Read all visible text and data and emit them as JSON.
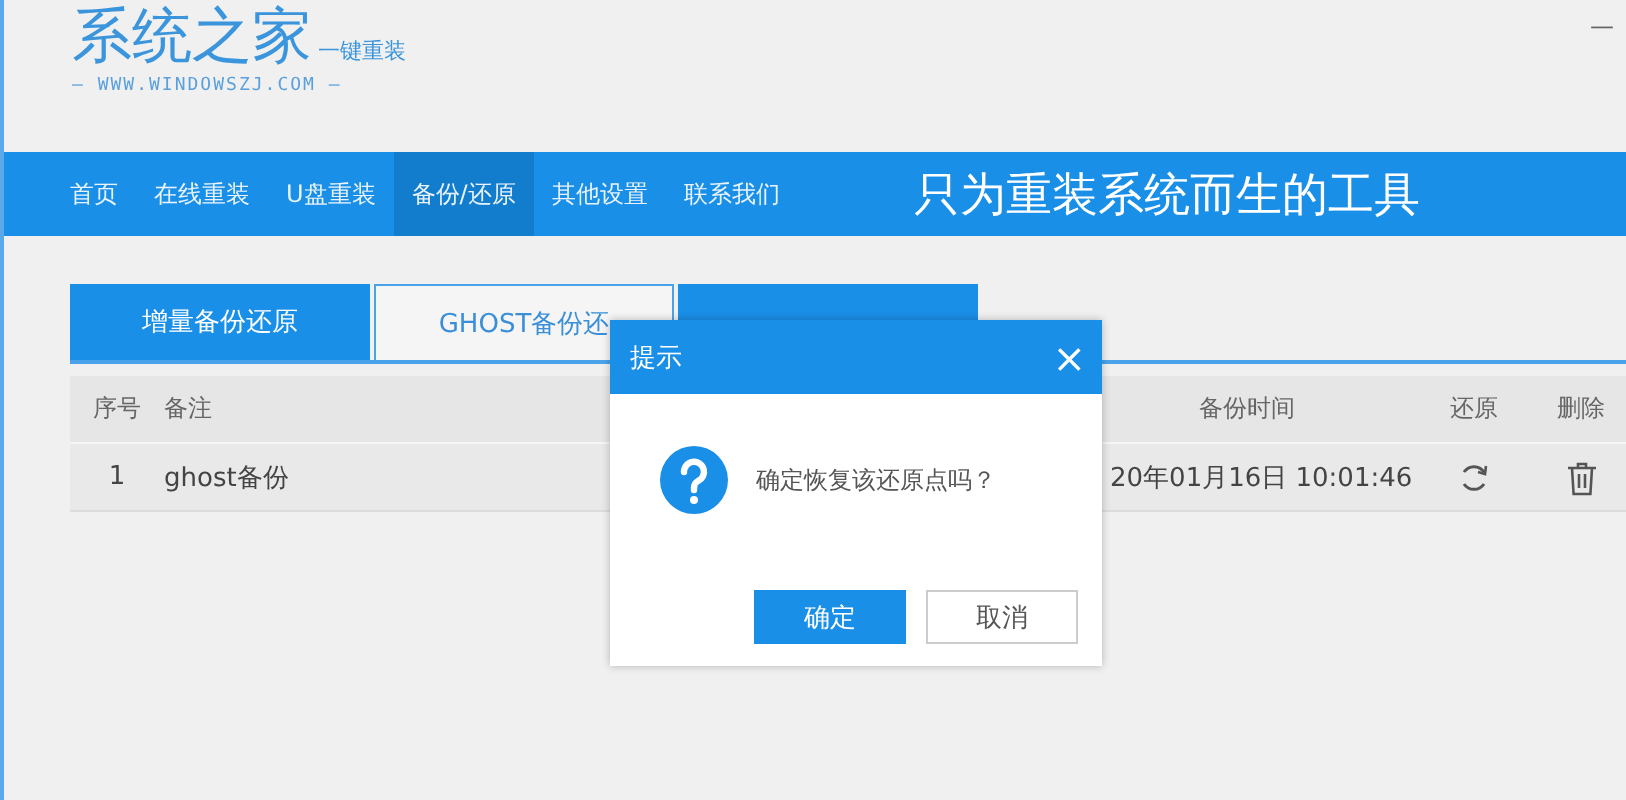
{
  "logo": {
    "title": "系统之家",
    "tagline": "一键重装",
    "url": "— WWW.WINDOWSZJ.COM —"
  },
  "window_controls": {
    "minimize": "—"
  },
  "nav": [
    {
      "label": "首页",
      "selected": false
    },
    {
      "label": "在线重装",
      "selected": false
    },
    {
      "label": "U盘重装",
      "selected": false
    },
    {
      "label": "备份/还原",
      "selected": true
    },
    {
      "label": "其他设置",
      "selected": false
    },
    {
      "label": "联系我们",
      "selected": false
    }
  ],
  "slogan": "只为重装系统而生的工具",
  "tabs": [
    {
      "label": "增量备份还原",
      "selected": false
    },
    {
      "label": "GHOST备份还",
      "selected": true
    },
    {
      "selected": false
    }
  ],
  "table": {
    "columns": [
      "序号",
      "备注",
      "备份时间",
      "还原",
      "删除"
    ],
    "rows": [
      {
        "index": "1",
        "note": "ghost备份",
        "time": "20年01月16日 10:01:46"
      }
    ]
  },
  "dialog": {
    "title": "提示",
    "close": "×",
    "message": "确定恢复该还原点吗？",
    "buttons": [
      {
        "label": "确定",
        "kind": "primary"
      },
      {
        "label": "取消",
        "kind": "secondary"
      }
    ]
  }
}
